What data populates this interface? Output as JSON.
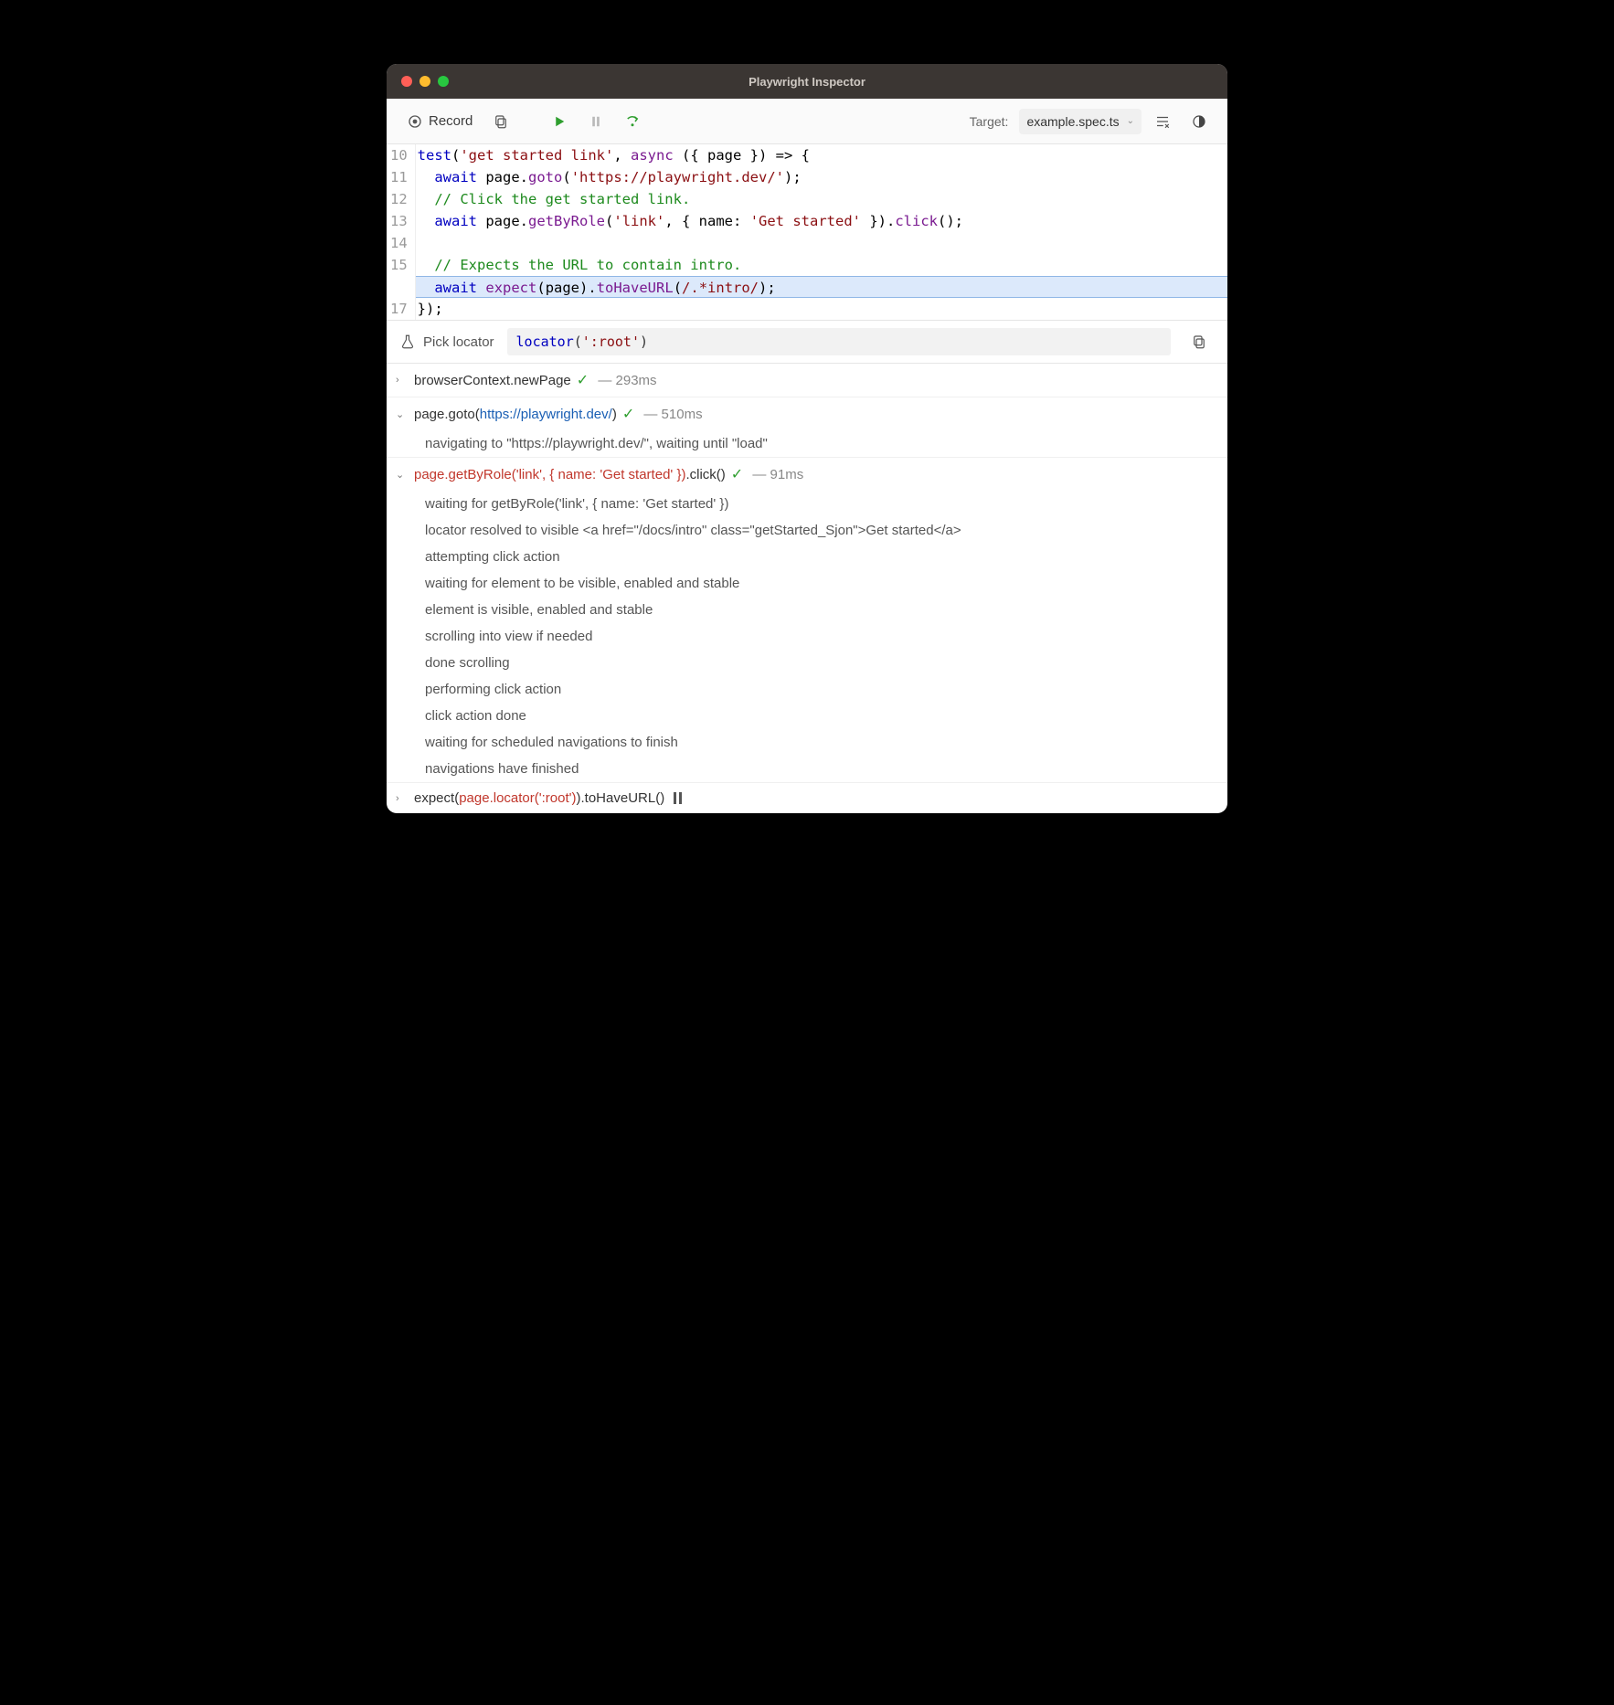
{
  "titlebar": {
    "title": "Playwright Inspector"
  },
  "toolbar": {
    "record": "Record",
    "target_label": "Target:",
    "target_value": "example.spec.ts"
  },
  "editor": {
    "lines": [
      {
        "n": "10",
        "pre": "",
        "html": "<span class='kw'>test</span>(<span class='str'>'get started link'</span>, <span class='fn'>async</span> ({ page }) =&gt; {"
      },
      {
        "n": "11",
        "pre": "  ",
        "html": "<span class='kw'>await</span> page.<span class='fn'>goto</span>(<span class='str'>'https://playwright.dev/'</span>);"
      },
      {
        "n": "12",
        "pre": "  ",
        "html": "<span class='cm'>// Click the get started link.</span>"
      },
      {
        "n": "13",
        "pre": "  ",
        "html": "<span class='kw'>await</span> page.<span class='fn'>getByRole</span>(<span class='str'>'link'</span>, { name: <span class='str'>'Get started'</span> }).<span class='fn'>click</span>();"
      },
      {
        "n": "14",
        "pre": "",
        "html": ""
      },
      {
        "n": "15",
        "pre": "  ",
        "html": "<span class='cm'>// Expects the URL to contain intro.</span>"
      },
      {
        "n": "",
        "pre": "  ",
        "hl": true,
        "html": "<span class='kw'>await</span> <span class='fn'>expect</span>(page).<span class='fn'>toHaveURL</span>(<span class='rgx'>/.*intro/</span>);"
      },
      {
        "n": "17",
        "pre": "",
        "html": "});"
      }
    ]
  },
  "locator": {
    "pick_label": "Pick locator",
    "value_html": "<span class='fn'>locator</span>(<span class='str'>':root'</span>)"
  },
  "calls": [
    {
      "type": "row",
      "arrow": "›",
      "text_html": "browserContext.newPage",
      "check": true,
      "ms": "293ms"
    },
    {
      "type": "row",
      "arrow": "⌄",
      "text_html": "page.goto(<span class='blue-t'>https://playwright.dev/</span>)",
      "check": true,
      "ms": "510ms"
    },
    {
      "type": "sub",
      "text": "navigating to \"https://playwright.dev/\", waiting until \"load\""
    },
    {
      "type": "row",
      "arrow": "⌄",
      "text_html": "<span class='red-t'>page.getByRole('link', { name: 'Get started' })</span>.click()",
      "check": true,
      "ms": "91ms"
    },
    {
      "type": "sub",
      "text": "waiting for getByRole('link', { name: 'Get started' })"
    },
    {
      "type": "sub",
      "text": "locator resolved to visible <a href=\"/docs/intro\" class=\"getStarted_Sjon\">Get started</a>"
    },
    {
      "type": "sub",
      "text": "attempting click action"
    },
    {
      "type": "sub",
      "text": "waiting for element to be visible, enabled and stable"
    },
    {
      "type": "sub",
      "text": "element is visible, enabled and stable"
    },
    {
      "type": "sub",
      "text": "scrolling into view if needed"
    },
    {
      "type": "sub",
      "text": "done scrolling"
    },
    {
      "type": "sub",
      "text": "performing click action"
    },
    {
      "type": "sub",
      "text": "click action done"
    },
    {
      "type": "sub",
      "text": "waiting for scheduled navigations to finish"
    },
    {
      "type": "sub",
      "text": "navigations have finished"
    },
    {
      "type": "row",
      "arrow": "›",
      "text_html": "expect(<span class='red-t'>page.locator(':root')</span>).toHaveURL()",
      "paused": true
    }
  ]
}
